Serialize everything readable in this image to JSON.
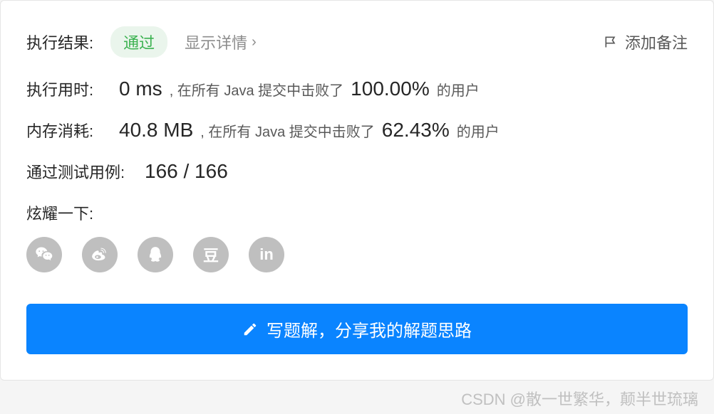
{
  "header": {
    "resultLabel": "执行结果:",
    "status": "通过",
    "showDetails": "显示详情",
    "addNote": "添加备注"
  },
  "stats": {
    "runtime": {
      "label": "执行用时:",
      "value": "0 ms",
      "text1": ", 在所有 Java 提交中击败了",
      "percent": "100.00%",
      "text2": "的用户"
    },
    "memory": {
      "label": "内存消耗:",
      "value": "40.8 MB",
      "text1": ", 在所有 Java 提交中击败了",
      "percent": "62.43%",
      "text2": "的用户"
    },
    "testcases": {
      "label": "通过测试用例:",
      "value": "166 / 166"
    }
  },
  "share": {
    "label": "炫耀一下:",
    "icons": [
      "wechat",
      "weibo",
      "qq",
      "douban",
      "linkedin"
    ]
  },
  "cta": {
    "label": "写题解，分享我的解题思路"
  },
  "watermark": "CSDN @散一世繁华，颠半世琉璃"
}
